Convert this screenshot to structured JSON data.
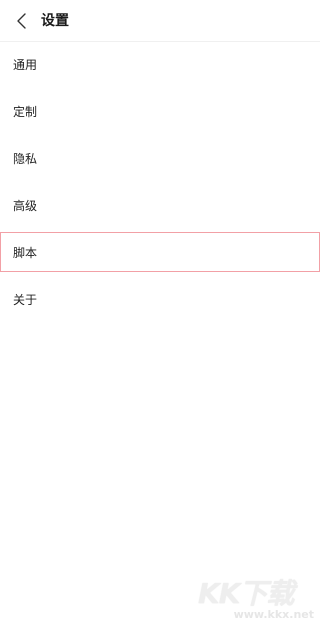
{
  "header": {
    "title": "设置",
    "back_icon": "chevron-left-icon"
  },
  "menu": {
    "items": [
      {
        "label": "通用"
      },
      {
        "label": "定制"
      },
      {
        "label": "隐私"
      },
      {
        "label": "高级"
      },
      {
        "label": "脚本",
        "selected": true
      },
      {
        "label": "关于"
      }
    ]
  },
  "watermark": {
    "logo": "KK下载",
    "url": "www.kkx.net"
  },
  "colors": {
    "selected_border": "#f2a0a6",
    "text": "#222222",
    "background": "#ffffff"
  }
}
